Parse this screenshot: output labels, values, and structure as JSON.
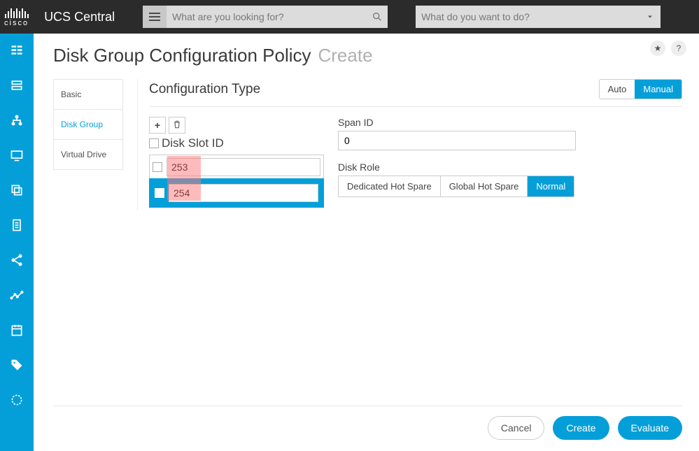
{
  "brand": {
    "vendor": "cisco",
    "product": "UCS Central"
  },
  "topbar": {
    "search_placeholder": "What are you looking for?",
    "action_placeholder": "What do you want to do?"
  },
  "rail": {
    "items": [
      "servers",
      "storage",
      "network",
      "display",
      "copy",
      "document",
      "share",
      "analytics",
      "calendar",
      "tag",
      "refresh"
    ]
  },
  "page": {
    "title": "Disk Group Configuration Policy",
    "title_suffix": "Create",
    "star_label": "★",
    "help_label": "?"
  },
  "sidenav": {
    "items": [
      {
        "label": "Basic",
        "active": false
      },
      {
        "label": "Disk Group",
        "active": true
      },
      {
        "label": "Virtual Drive",
        "active": false
      }
    ]
  },
  "config": {
    "section_title": "Configuration Type",
    "mode": {
      "options": [
        "Auto",
        "Manual"
      ],
      "active": "Manual"
    },
    "toolbar": {
      "add_glyph": "+",
      "delete_glyph": "🗑"
    },
    "disk_slot": {
      "header": "Disk Slot ID",
      "rows": [
        {
          "value": "253",
          "selected": false
        },
        {
          "value": "254",
          "selected": true
        }
      ]
    },
    "span_id": {
      "label": "Span ID",
      "value": "0"
    },
    "disk_role": {
      "label": "Disk Role",
      "options": [
        "Dedicated Hot Spare",
        "Global Hot Spare",
        "Normal"
      ],
      "active": "Normal"
    }
  },
  "footer": {
    "cancel": "Cancel",
    "create": "Create",
    "evaluate": "Evaluate"
  }
}
